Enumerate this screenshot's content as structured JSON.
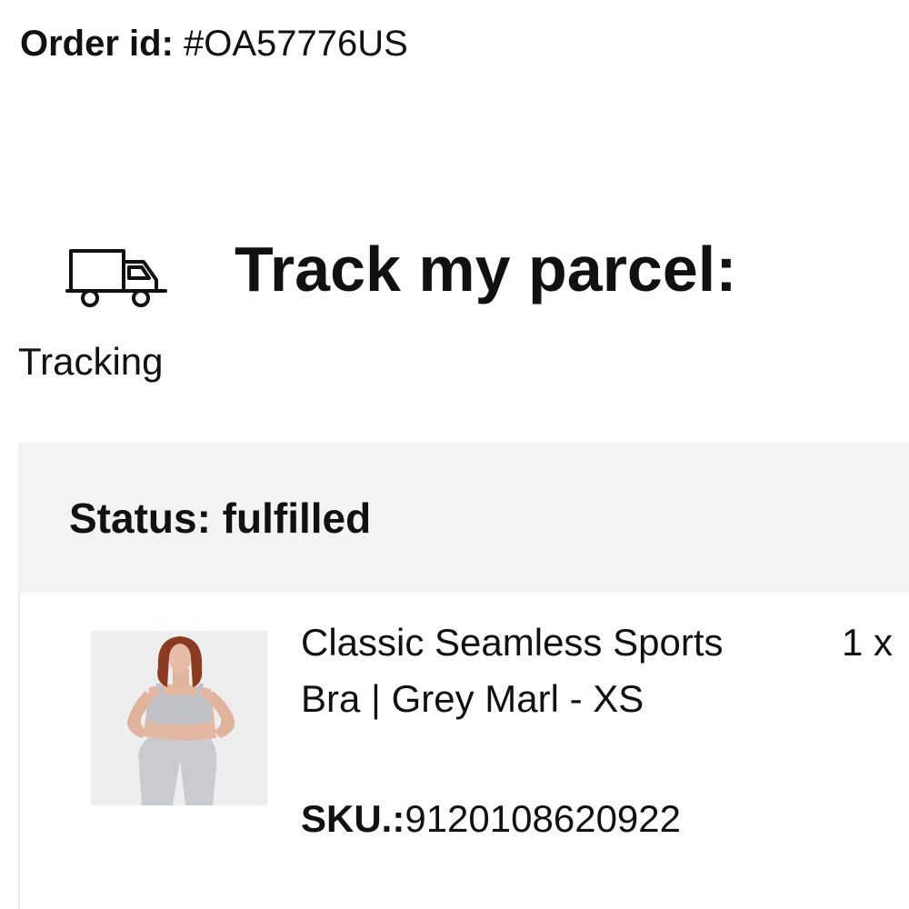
{
  "order": {
    "id_label": "Order id:",
    "id_value": " #OA57776US"
  },
  "tracking": {
    "icon": "truck-icon",
    "label": "Tracking",
    "heading": "Track my parcel:"
  },
  "status": {
    "text": "Status: fulfilled",
    "background_color": "#f3f3f3"
  },
  "item": {
    "image_icon": "product-photo",
    "name": "Classic Seamless Sports Bra | Grey Marl - XS",
    "sku_label": "SKU.:",
    "sku_value": "9120108620922",
    "quantity": "1 x"
  }
}
